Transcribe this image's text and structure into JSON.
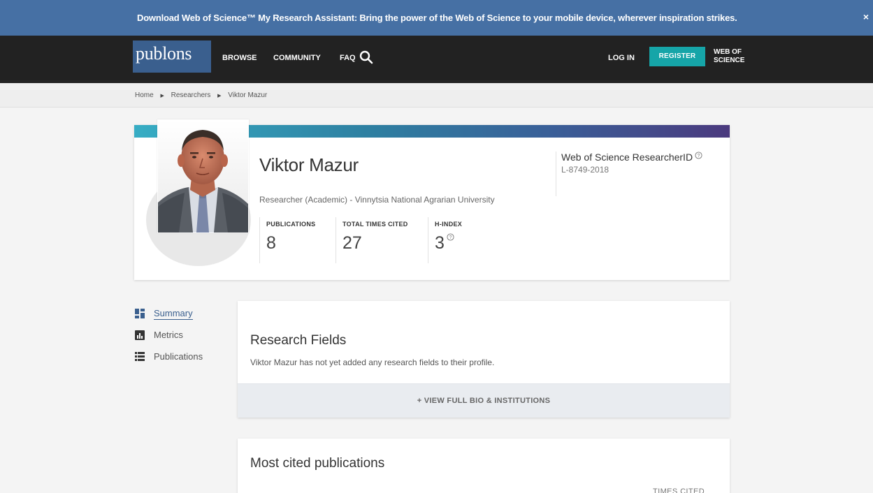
{
  "banner": {
    "text": "Download Web of Science™ My Research Assistant: Bring the power of the Web of Science to your mobile device, wherever inspiration strikes.",
    "close_label": "×"
  },
  "nav": {
    "logo": "publons",
    "links": [
      "BROWSE",
      "COMMUNITY",
      "FAQ"
    ],
    "search_icon": "search-icon",
    "login": "LOG IN",
    "register": "REGISTER",
    "wos_line1": "WEB OF",
    "wos_line2": "SCIENCE"
  },
  "breadcrumb": [
    "Home",
    "Researchers",
    "Viktor Mazur"
  ],
  "profile": {
    "name": "Viktor Mazur",
    "affiliation": "Researcher (Academic) - Vinnytsia National Agrarian University",
    "metrics": [
      {
        "label": "PUBLICATIONS",
        "value": "8"
      },
      {
        "label": "TOTAL TIMES CITED",
        "value": "27"
      },
      {
        "label": "H-INDEX",
        "value": "3"
      }
    ],
    "rid_title": "Web of Science ResearcherID",
    "rid_value": "L-8749-2018",
    "gradient_colors": [
      "#37adc4",
      "#2e7fa1",
      "#3a5f98",
      "#4b3a7e"
    ]
  },
  "side_nav": [
    {
      "label": "Summary",
      "icon": "dashboard-icon",
      "active": true
    },
    {
      "label": "Metrics",
      "icon": "bar-chart-icon",
      "active": false
    },
    {
      "label": "Publications",
      "icon": "list-icon",
      "active": false
    }
  ],
  "research_fields": {
    "title": "Research Fields",
    "text": "Viktor Mazur has not yet added any research fields to their profile.",
    "button": "+ VIEW FULL BIO & INSTITUTIONS"
  },
  "most_cited": {
    "title": "Most cited publications",
    "column": "TIMES CITED"
  },
  "colors": {
    "banner": "#4670a4",
    "nav": "#222222",
    "register": "#16a5a8",
    "accent": "#3a5f8e"
  }
}
